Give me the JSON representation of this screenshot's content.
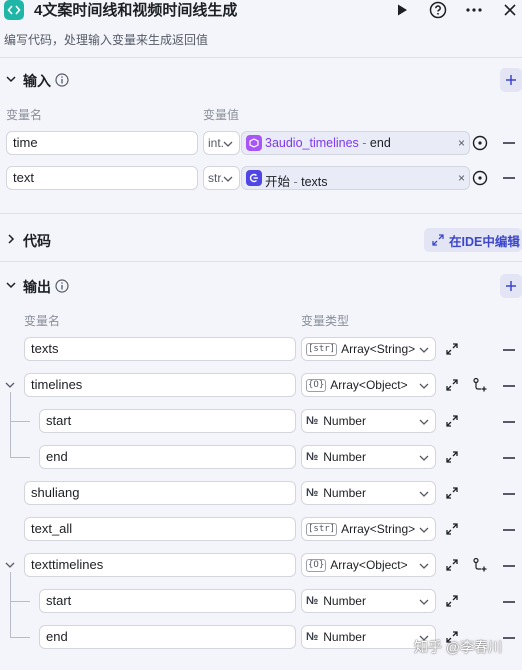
{
  "header": {
    "title": "4文案时间线和视频时间线生成",
    "description": "编写代码，处理输入变量来生成返回值"
  },
  "input_section": {
    "title": "输入",
    "col_name": "变量名",
    "col_value": "变量值",
    "rows": [
      {
        "name": "time",
        "type": "int.",
        "ref_source": "3audio_timelines",
        "ref_sep": " - ",
        "ref_field": "end"
      },
      {
        "name": "text",
        "type": "str.",
        "ref_source": "开始",
        "ref_sep": " - ",
        "ref_field": "texts"
      }
    ]
  },
  "code_section": {
    "title": "代码",
    "ide_button": "在IDE中编辑"
  },
  "output_section": {
    "title": "输出",
    "col_name": "变量名",
    "col_type": "变量类型",
    "rows": [
      {
        "name": "texts",
        "badge": "[str]",
        "type": "Array<String>"
      },
      {
        "name": "timelines",
        "badge": "{O}",
        "type": "Array<Object>"
      },
      {
        "name": "start",
        "badge": "№",
        "type": "Number"
      },
      {
        "name": "end",
        "badge": "№",
        "type": "Number"
      },
      {
        "name": "shuliang",
        "badge": "№",
        "type": "Number"
      },
      {
        "name": "text_all",
        "badge": "[str]",
        "type": "Array<String>"
      },
      {
        "name": "texttimelines",
        "badge": "{O}",
        "type": "Array<Object>"
      },
      {
        "name": "start",
        "badge": "№",
        "type": "Number"
      },
      {
        "name": "end",
        "badge": "№",
        "type": "Number"
      }
    ]
  },
  "watermark": "知乎 @李春川",
  "colors": {
    "accent": "#3c46c9",
    "app_icon": "#1fb6a8",
    "node_audio": "#a855f7",
    "node_start": "#4f46e5"
  }
}
